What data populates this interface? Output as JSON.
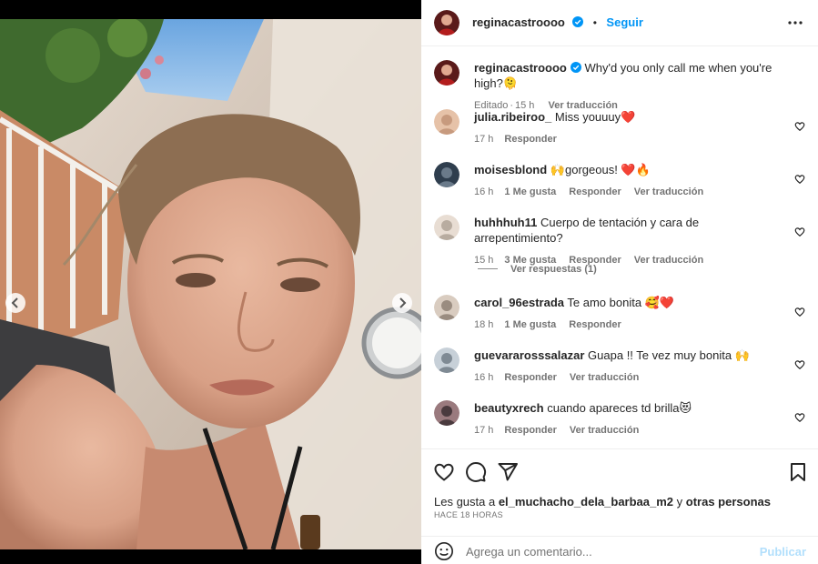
{
  "post": {
    "username": "reginacastroooo",
    "follow_label": "Seguir",
    "dot": "•",
    "caption": "Why'd you only call me when you're high?🫠",
    "caption_edited": "Editado",
    "caption_time": "15 h",
    "caption_translate": "Ver traducción"
  },
  "comments": [
    {
      "user": "julia.ribeiroo_",
      "text": "Miss youuuy❤️",
      "time": "17 h",
      "likes": "",
      "reply": "Responder",
      "translate": ""
    },
    {
      "user": "moisesblond",
      "text": "🙌gorgeous! ❤️🔥",
      "time": "16 h",
      "likes": "1 Me gusta",
      "reply": "Responder",
      "translate": "Ver traducción"
    },
    {
      "user": "huhhhuh11",
      "text": "Cuerpo de tentación y cara de arrepentimiento?",
      "time": "15 h",
      "likes": "3 Me gusta",
      "reply": "Responder",
      "translate": "Ver traducción"
    },
    {
      "user": "carol_96estrada",
      "text": "Te amo bonita 🥰❤️",
      "time": "18 h",
      "likes": "1 Me gusta",
      "reply": "Responder",
      "translate": ""
    },
    {
      "user": "guevararosssalazar",
      "text": "Guapa !! Te vez muy bonita 🙌",
      "time": "16 h",
      "likes": "",
      "reply": "Responder",
      "translate": "Ver traducción"
    },
    {
      "user": "beautyxrech",
      "text": "cuando apareces td brilla😻",
      "time": "17 h",
      "likes": "",
      "reply": "Responder",
      "translate": "Ver traducción"
    }
  ],
  "view_replies": "Ver respuestas (1)",
  "likes_line": {
    "prefix": "Les gusta a ",
    "user": "el_muchacho_dela_barbaa_m2",
    "mid": " y ",
    "others": "otras personas"
  },
  "time_ago": "HACE 18 HORAS",
  "add_comment": {
    "placeholder": "Agrega un comentario...",
    "publish": "Publicar"
  },
  "colors": {
    "accent": "#0095f6",
    "heart": "#ed4956",
    "publish_disabled": "#b2dffc"
  }
}
